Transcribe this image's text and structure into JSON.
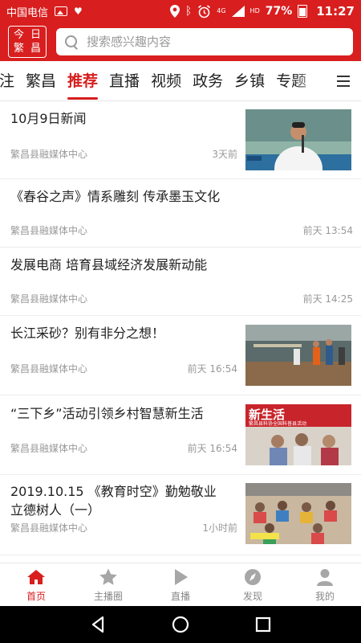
{
  "status_bar": {
    "carrier": "中国电信",
    "network_type": "4G",
    "hd": "HD",
    "battery": "77%",
    "time": "11:27"
  },
  "header": {
    "logo_chars": [
      "今",
      "日",
      "繁",
      "昌"
    ],
    "search_placeholder": "搜索感兴趣内容",
    "accent_color": "#d81e1e"
  },
  "tabs": [
    {
      "label": "注"
    },
    {
      "label": "繁昌"
    },
    {
      "label": "推荐",
      "active": true
    },
    {
      "label": "直播"
    },
    {
      "label": "视频"
    },
    {
      "label": "政务"
    },
    {
      "label": "乡镇"
    },
    {
      "label": "专题"
    }
  ],
  "news": [
    {
      "title": "10月9日新闻",
      "source": "繁昌县融媒体中心",
      "time": "3天前",
      "has_image": true,
      "image_icon": "news-anchor-photo"
    },
    {
      "title": "《春谷之声》情系雕刻 传承墨玉文化",
      "source": "繁昌县融媒体中心",
      "time": "前天 13:54",
      "has_image": false
    },
    {
      "title": "发展电商 培育县域经济发展新动能",
      "source": "繁昌县融媒体中心",
      "time": "前天 14:25",
      "has_image": false
    },
    {
      "title": "长江采砂？别有非分之想！",
      "source": "繁昌县融媒体中心",
      "time": "前天 16:54",
      "has_image": true,
      "image_icon": "river-boat-photo"
    },
    {
      "title": "“三下乡”活动引领乡村智慧新生活",
      "source": "繁昌县融媒体中心",
      "time": "前天 16:54",
      "has_image": true,
      "image_icon": "rural-event-photo",
      "image_banner": "新生活",
      "image_caption": "繁昌县科协全国科普县活动"
    },
    {
      "title_lines": [
        "2019.10.15 《教育时空》勤勉敬业",
        "立德树人（一）"
      ],
      "source": "繁昌县融媒体中心",
      "time": "1小时前",
      "has_image": true,
      "image_icon": "classroom-photo"
    }
  ],
  "bottom_nav": [
    {
      "label": "首页",
      "icon": "home-icon",
      "active": true
    },
    {
      "label": "主播圈",
      "icon": "star-icon"
    },
    {
      "label": "直播",
      "icon": "play-icon"
    },
    {
      "label": "发现",
      "icon": "compass-icon"
    },
    {
      "label": "我的",
      "icon": "person-icon"
    }
  ]
}
